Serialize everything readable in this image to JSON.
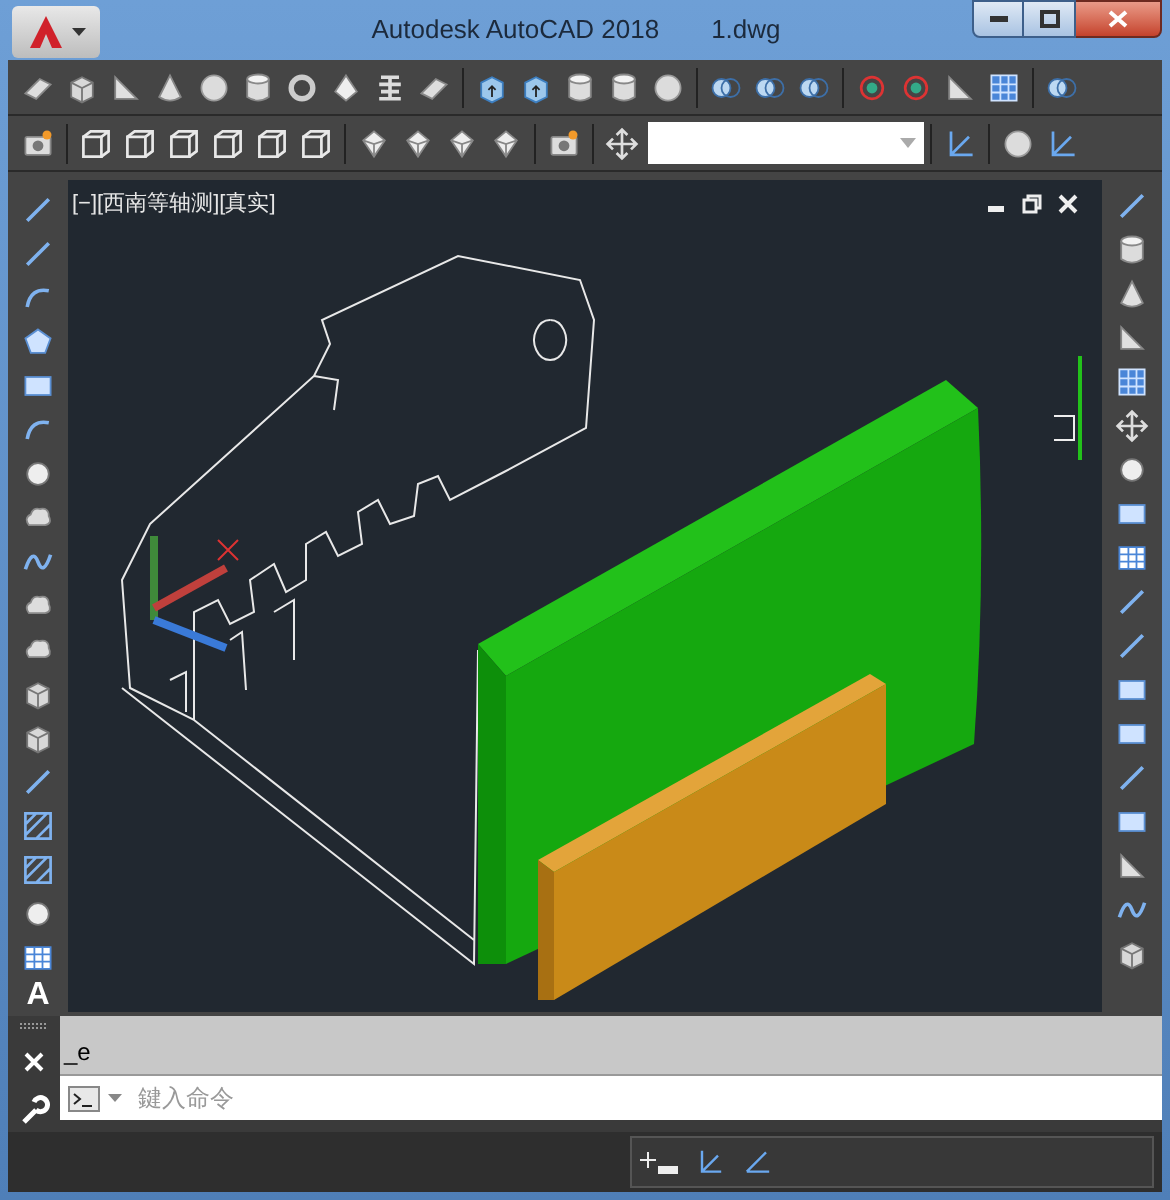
{
  "window": {
    "title": "Autodesk AutoCAD 2018",
    "document": "1.dwg"
  },
  "left_toolbar": {
    "text_tool": "A"
  },
  "viewport": {
    "label": "[−][西南等轴测][真实]"
  },
  "command_line": {
    "history": "_e",
    "placeholder": "鍵入命令"
  }
}
